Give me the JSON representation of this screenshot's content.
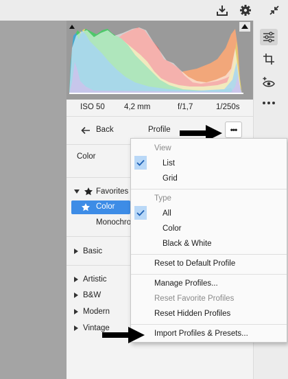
{
  "exif": {
    "iso": "ISO 50",
    "focal": "4,2 mm",
    "aperture": "f/1,7",
    "shutter": "1/250s"
  },
  "profile_header": {
    "back_label": "Back",
    "title": "Profile"
  },
  "treatment": {
    "value": "Color"
  },
  "groups": {
    "favorites": {
      "label": "Favorites",
      "items": [
        "Color",
        "Monochrome"
      ]
    },
    "basic": {
      "label": "Basic"
    },
    "artistic": {
      "label": "Artistic"
    },
    "bw": {
      "label": "B&W"
    },
    "modern": {
      "label": "Modern"
    },
    "vintage": {
      "label": "Vintage"
    }
  },
  "menu": {
    "view_header": "View",
    "view_options": [
      "List",
      "Grid"
    ],
    "type_header": "Type",
    "type_options": [
      "All",
      "Color",
      "Black & White"
    ],
    "reset_default": "Reset to Default Profile",
    "manage": "Manage Profiles...",
    "reset_favorites": "Reset Favorite Profiles",
    "reset_hidden": "Reset Hidden Profiles",
    "import": "Import Profiles & Presets..."
  },
  "icons": [
    "download-icon",
    "gear-icon",
    "collapse-icon",
    "sliders-icon",
    "crop-icon",
    "redeye-icon",
    "more-icon",
    "ellipsis-icon",
    "star-icon",
    "check-icon",
    "back-arrow-icon",
    "annotation-arrow-icon"
  ],
  "colors": {
    "accent": "#3d8ce6",
    "check_bg": "#b9d8f7"
  }
}
